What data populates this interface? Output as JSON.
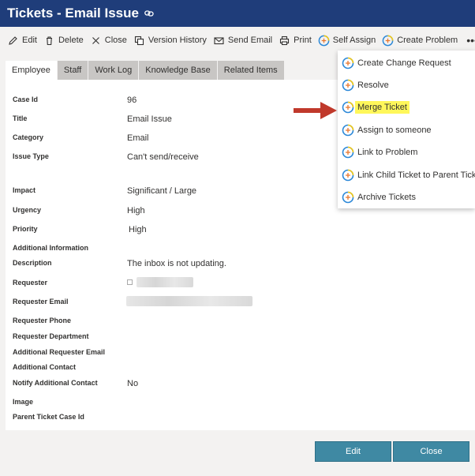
{
  "header": {
    "title": "Tickets - Email Issue"
  },
  "toolbar": {
    "edit": "Edit",
    "delete": "Delete",
    "close": "Close",
    "version_history": "Version History",
    "send_email": "Send Email",
    "print": "Print",
    "self_assign": "Self Assign",
    "create_problem": "Create Problem",
    "more": "•••"
  },
  "tabs": [
    "Employee",
    "Staff",
    "Work Log",
    "Knowledge Base",
    "Related Items"
  ],
  "fields": {
    "case_id": {
      "label": "Case Id",
      "value": "96"
    },
    "title": {
      "label": "Title",
      "value": "Email Issue"
    },
    "category": {
      "label": "Category",
      "value": "Email"
    },
    "issue_type": {
      "label": "Issue Type",
      "value": "Can't send/receive"
    },
    "impact": {
      "label": "Impact",
      "value": "Significant / Large"
    },
    "urgency": {
      "label": "Urgency",
      "value": "High"
    },
    "priority": {
      "label": "Priority",
      "value": "High"
    },
    "additional_information": {
      "label": "Additional Information"
    },
    "description": {
      "label": "Description",
      "value": "The inbox is not updating."
    },
    "requester": {
      "label": "Requester"
    },
    "requester_email": {
      "label": "Requester Email"
    },
    "requester_phone": {
      "label": "Requester Phone"
    },
    "requester_department": {
      "label": "Requester Department"
    },
    "additional_requester_email": {
      "label": "Additional Requester Email"
    },
    "additional_contact": {
      "label": "Additional Contact"
    },
    "notify_additional_contact": {
      "label": "Notify Additional Contact",
      "value": "No"
    },
    "image": {
      "label": "Image"
    },
    "parent_ticket_case_id": {
      "label": "Parent Ticket Case Id"
    }
  },
  "dropdown": {
    "items": [
      "Create Change Request",
      "Resolve",
      "Merge Ticket",
      "Assign to someone",
      "Link to Problem",
      "Link Child Ticket to Parent Ticket",
      "Archive Tickets"
    ],
    "highlighted": "Merge Ticket"
  },
  "footer": {
    "edit": "Edit",
    "close": "Close"
  },
  "colors": {
    "header": "#1f3d7a",
    "button": "#3f89a3",
    "highlight": "#fff75a",
    "arrow": "#c0392b"
  }
}
